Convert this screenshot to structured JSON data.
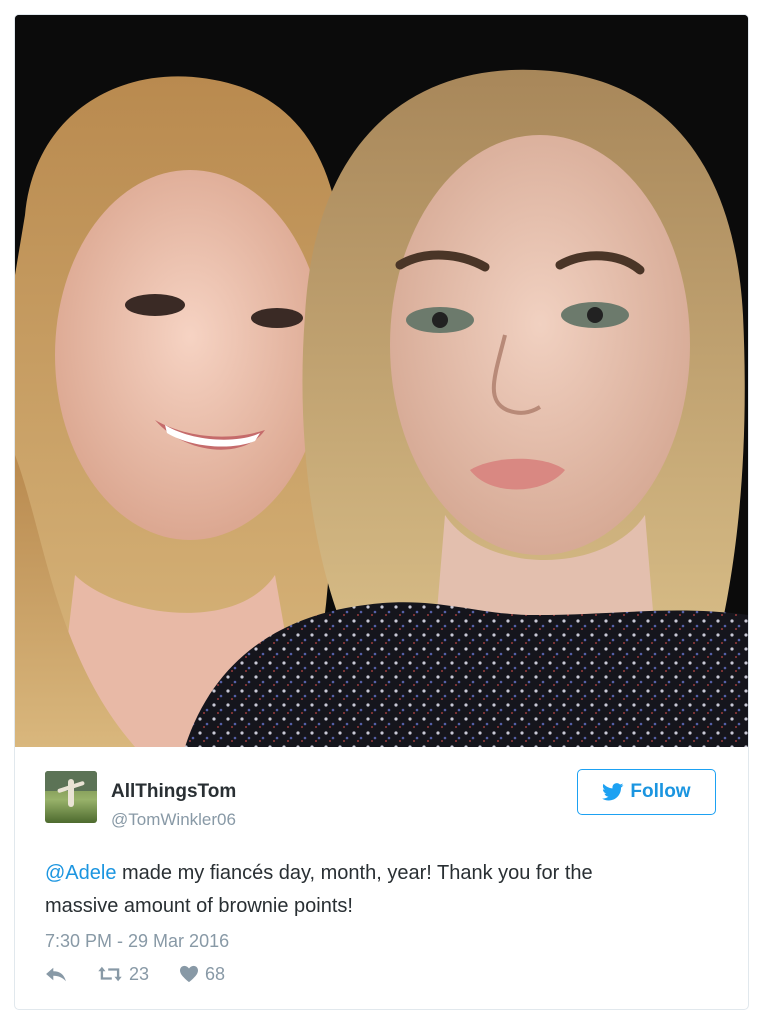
{
  "tweet": {
    "display_name": "AllThingsTom",
    "handle": "@TomWinkler06",
    "follow_label": "Follow",
    "mention": "@Adele",
    "text_line1": " made my fiancés day, month, year! Thank you for the",
    "text_line2": "massive amount of brownie points!",
    "timestamp": "7:30 PM - 29 Mar 2016",
    "retweets": "23",
    "likes": "68"
  },
  "photo": {
    "description_icon": "selfie-photo"
  },
  "colors": {
    "twitter_blue": "#1da1f2",
    "text_dark": "#292f33",
    "text_muted": "#8899a6",
    "border": "#e1e8ed"
  },
  "icons": {
    "reply": "reply-icon",
    "retweet": "retweet-icon",
    "like": "heart-icon",
    "follow": "twitter-bird-icon"
  }
}
